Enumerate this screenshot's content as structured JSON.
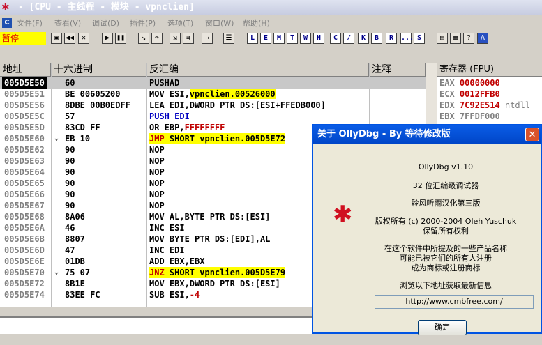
{
  "window": {
    "title": "- [CPU - 主线程 - 模块 - vpnclien]"
  },
  "menu": [
    "文件(F)",
    "查看(V)",
    "调试(D)",
    "插件(P)",
    "选项(T)",
    "窗口(W)",
    "帮助(H)"
  ],
  "toolbar": {
    "status": "暂停",
    "letters": [
      "L",
      "E",
      "M",
      "T",
      "W",
      "H",
      "C",
      "/",
      "K",
      "B",
      "R",
      "...",
      "S"
    ]
  },
  "cpu": {
    "headers": {
      "address": "地址",
      "hex": "十六进制",
      "disasm": "反汇编",
      "comment": "注释"
    },
    "rows": [
      {
        "addr": "005D5E50",
        "hex": "60",
        "dis": "PUSHAD",
        "selected": true
      },
      {
        "addr": "005D5E51",
        "hex": "BE 00605200",
        "dis": "MOV ESI,",
        "arg": "vpnclien.00526000",
        "arg_hl": true
      },
      {
        "addr": "005D5E56",
        "hex": "8DBE 00B0EDFF",
        "dis": "LEA EDI,DWORD PTR DS:[ESI+FFEDB000]"
      },
      {
        "addr": "005D5E5C",
        "hex": "57",
        "dis": "PUSH EDI",
        "blue": true
      },
      {
        "addr": "005D5E5D",
        "hex": "83CD FF",
        "dis": "OR EBP,",
        "arg": "FFFFFFFF",
        "arg_red": true
      },
      {
        "addr": "005D5E60",
        "hex": "EB 10",
        "jmp": "⌄",
        "dis": "JMP SHORT vpnclien.005D5E72",
        "jump": "JMP",
        "jump_rest": " SHORT vpnclien.005D5E72"
      },
      {
        "addr": "005D5E62",
        "hex": "90",
        "dis": "NOP"
      },
      {
        "addr": "005D5E63",
        "hex": "90",
        "dis": "NOP"
      },
      {
        "addr": "005D5E64",
        "hex": "90",
        "dis": "NOP"
      },
      {
        "addr": "005D5E65",
        "hex": "90",
        "dis": "NOP"
      },
      {
        "addr": "005D5E66",
        "hex": "90",
        "dis": "NOP"
      },
      {
        "addr": "005D5E67",
        "hex": "90",
        "dis": "NOP"
      },
      {
        "addr": "005D5E68",
        "hex": "8A06",
        "dis": "MOV AL,BYTE PTR DS:[ESI]"
      },
      {
        "addr": "005D5E6A",
        "hex": "46",
        "dis": "INC ESI"
      },
      {
        "addr": "005D5E6B",
        "hex": "8807",
        "dis": "MOV BYTE PTR DS:[EDI],AL"
      },
      {
        "addr": "005D5E6D",
        "hex": "47",
        "dis": "INC EDI"
      },
      {
        "addr": "005D5E6E",
        "hex": "01DB",
        "dis": "ADD EBX,EBX"
      },
      {
        "addr": "005D5E70",
        "hex": "75 07",
        "jmp": "⌄",
        "dis": "JNZ SHORT vpnclien.005D5E79",
        "jump": "JNZ",
        "jump_rest": " SHORT vpnclien.005D5E79"
      },
      {
        "addr": "005D5E72",
        "hex": "8B1E",
        "dis": "MOV EBX,DWORD PTR DS:[ESI]"
      },
      {
        "addr": "005D5E74",
        "hex": "83EE FC",
        "dis": "SUB ESI,",
        "arg": "-4",
        "arg_red": true
      }
    ]
  },
  "registers": {
    "header": "寄存器 (FPU)",
    "rows": [
      {
        "name": "EAX",
        "value": "00000000",
        "extra": ""
      },
      {
        "name": "ECX",
        "value": "0012FFB0",
        "extra": ""
      },
      {
        "name": "EDX",
        "value": "7C92E514",
        "extra": "ntdll"
      },
      {
        "name": "EBX",
        "value": "7FFDF000",
        "extra": ""
      }
    ]
  },
  "about_dialog": {
    "title": "关于 OllyDbg - By 等待修改版",
    "lines": [
      "OllyDbg v1.10",
      "32 位汇编级调试器",
      "聆风听雨汉化第三版",
      "版权所有 (c) 2000-2004 Oleh Yuschuk",
      "保留所有权利",
      "在这个软件中所提及的一些产品名称",
      "可能已被它们的所有人注册",
      "成为商标或注册商标",
      "浏览以下地址获取最新信息"
    ],
    "url": "http://www.cmbfree.com/",
    "ok_label": "确定"
  }
}
